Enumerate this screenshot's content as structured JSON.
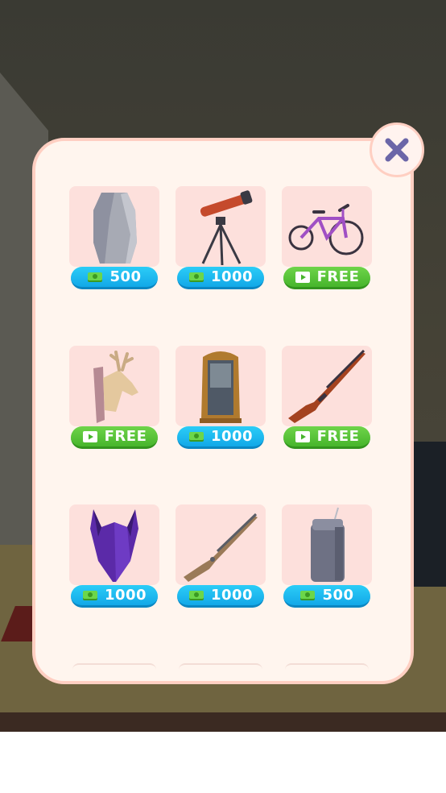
{
  "shop": {
    "items": [
      {
        "name": "vase",
        "price": "500",
        "kind": "coin"
      },
      {
        "name": "telescope",
        "price": "1000",
        "kind": "coin"
      },
      {
        "name": "bicycle",
        "price": "FREE",
        "kind": "free"
      },
      {
        "name": "deer-trophy",
        "price": "FREE",
        "kind": "free"
      },
      {
        "name": "grandfather-clock",
        "price": "1000",
        "kind": "coin"
      },
      {
        "name": "rifle",
        "price": "FREE",
        "kind": "free"
      },
      {
        "name": "demon-mask",
        "price": "1000",
        "kind": "coin"
      },
      {
        "name": "musket",
        "price": "1000",
        "kind": "coin"
      },
      {
        "name": "thermos",
        "price": "500",
        "kind": "coin"
      }
    ],
    "close_icon": "close-icon",
    "coin_icon": "cash-icon",
    "free_icon": "play-video-icon",
    "colors": {
      "coin_button": "#12a8e8",
      "free_button": "#47b52c",
      "panel": "#fff5ee",
      "panel_border": "#ffcfc2",
      "thumb": "#fde0dc",
      "close_x": "#6b66a8"
    }
  }
}
